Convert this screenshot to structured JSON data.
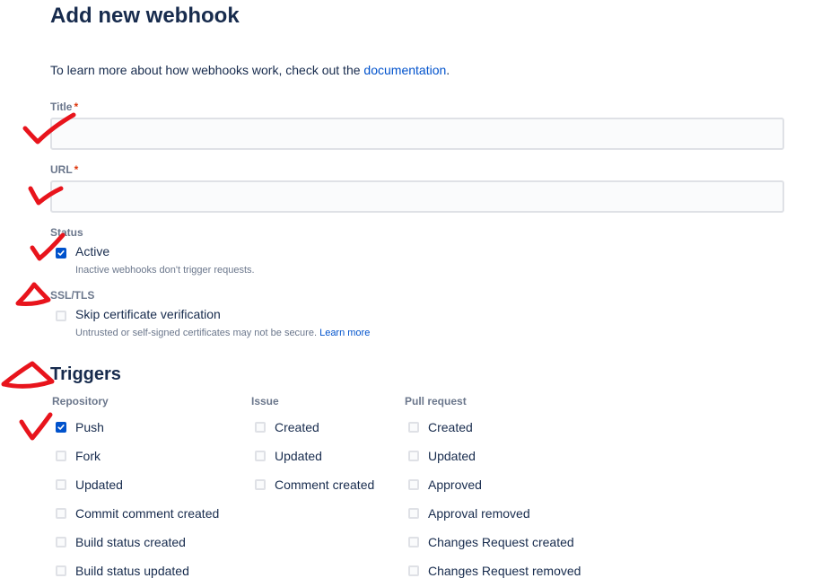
{
  "page": {
    "title": "Add new webhook",
    "intro_text": "To learn more about how webhooks work, check out the ",
    "intro_link": "documentation",
    "intro_end": "."
  },
  "form": {
    "title_label": "Title",
    "title_value": "",
    "url_label": "URL",
    "url_value": "",
    "required_mark": "*",
    "status_label": "Status",
    "active_label": "Active",
    "active_checked": true,
    "active_helper": "Inactive webhooks don't trigger requests.",
    "ssl_label": "SSL/TLS",
    "skip_cert_label": "Skip certificate verification",
    "skip_cert_checked": false,
    "skip_cert_helper": "Untrusted or self-signed certificates may not be secure.",
    "learn_more": "Learn more"
  },
  "triggers": {
    "title": "Triggers",
    "repository": {
      "header": "Repository",
      "items": [
        {
          "label": "Push",
          "checked": true
        },
        {
          "label": "Fork",
          "checked": false
        },
        {
          "label": "Updated",
          "checked": false
        },
        {
          "label": "Commit comment created",
          "checked": false
        },
        {
          "label": "Build status created",
          "checked": false
        },
        {
          "label": "Build status updated",
          "checked": false
        }
      ]
    },
    "issue": {
      "header": "Issue",
      "items": [
        {
          "label": "Created",
          "checked": false
        },
        {
          "label": "Updated",
          "checked": false
        },
        {
          "label": "Comment created",
          "checked": false
        }
      ]
    },
    "pull_request": {
      "header": "Pull request",
      "items": [
        {
          "label": "Created",
          "checked": false
        },
        {
          "label": "Updated",
          "checked": false
        },
        {
          "label": "Approved",
          "checked": false
        },
        {
          "label": "Approval removed",
          "checked": false
        },
        {
          "label": "Changes Request created",
          "checked": false
        },
        {
          "label": "Changes Request removed",
          "checked": false
        }
      ]
    }
  },
  "colors": {
    "accent": "#0052cc",
    "annotation": "#e8141c",
    "required": "#de350b"
  },
  "annotations": [
    {
      "kind": "check-mark",
      "target": "title-field"
    },
    {
      "kind": "check-mark",
      "target": "url-field"
    },
    {
      "kind": "check-mark",
      "target": "status-active"
    },
    {
      "kind": "triangle-mark",
      "target": "ssl-tls"
    },
    {
      "kind": "triangle-mark",
      "target": "triggers"
    },
    {
      "kind": "check-mark",
      "target": "trigger-push"
    }
  ]
}
